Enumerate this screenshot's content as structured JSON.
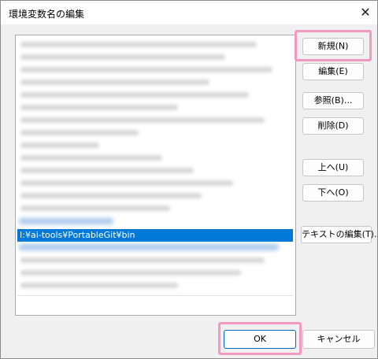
{
  "window": {
    "title": "環境変数名の編集"
  },
  "list": {
    "selected_item": "I:¥ai-tools¥PortableGit¥bin"
  },
  "buttons": {
    "new": "新規(N)",
    "edit": "編集(E)",
    "browse": "参照(B)...",
    "delete": "削除(D)",
    "up": "上へ(U)",
    "down": "下へ(O)",
    "edit_text": "テキストの編集(T)...",
    "ok": "OK",
    "cancel": "キャンセル"
  },
  "colors": {
    "selection": "#0078d7",
    "highlight": "#f199c0"
  },
  "icons": {
    "close": "close-icon"
  }
}
